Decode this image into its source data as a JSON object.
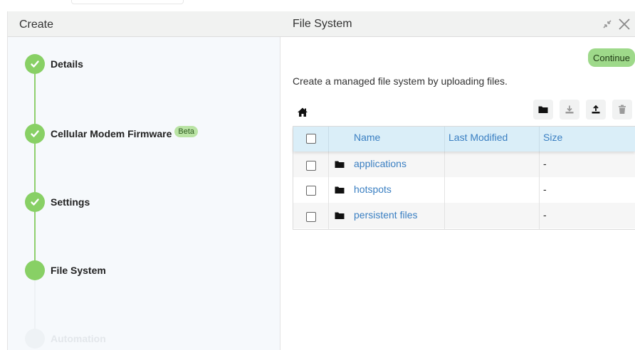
{
  "left_header": {
    "title": "Create"
  },
  "right_header": {
    "title": "File System"
  },
  "steps": [
    {
      "label": "Details",
      "status": "complete"
    },
    {
      "label": "Cellular Modem Firmware",
      "status": "complete",
      "badge": "Beta"
    },
    {
      "label": "Settings",
      "status": "complete"
    },
    {
      "label": "File System",
      "status": "current"
    },
    {
      "label": "Automation",
      "status": "upcoming"
    }
  ],
  "main": {
    "continue_label": "Continue",
    "description": "Create a managed file system by uploading files.",
    "toolbar": {
      "icons": [
        "folder-icon",
        "download-icon",
        "upload-icon",
        "trash-icon"
      ]
    },
    "table": {
      "columns": [
        "Name",
        "Last Modified",
        "Size"
      ],
      "rows": [
        {
          "name": "applications",
          "last_modified": "",
          "size": "-"
        },
        {
          "name": "hotspots",
          "last_modified": "",
          "size": "-"
        },
        {
          "name": "persistent files",
          "last_modified": "",
          "size": "-"
        }
      ]
    }
  },
  "colors": {
    "accent_green": "#88d065",
    "link_blue": "#3a7fc2",
    "table_header_bg": "#daeef8"
  }
}
